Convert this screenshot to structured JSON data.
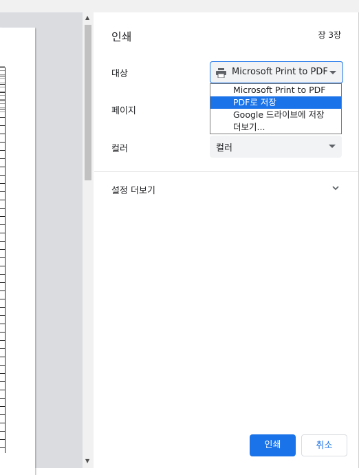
{
  "panel": {
    "title": "인쇄",
    "sheet_count": "장 3장",
    "destination_label": "대상",
    "destination_value": "Microsoft Print to PDF",
    "destination_options": [
      "Microsoft Print to PDF",
      "PDF로 저장",
      "Google 드라이브에 저장",
      "더보기..."
    ],
    "highlighted_option": "PDF로 저장",
    "pages_label": "페이지",
    "color_label": "컬러",
    "color_value": "컬러",
    "more_settings_label": "설정 더보기",
    "print_button": "인쇄",
    "cancel_button": "취소"
  },
  "icons": [
    "printer-icon",
    "caret-down-icon",
    "chevron-down-icon",
    "scroll-up-arrow",
    "scroll-down-arrow"
  ],
  "colors": {
    "accent": "#1a73e8",
    "preview_bg": "#dadce0",
    "select_bg": "#f1f3f4"
  }
}
